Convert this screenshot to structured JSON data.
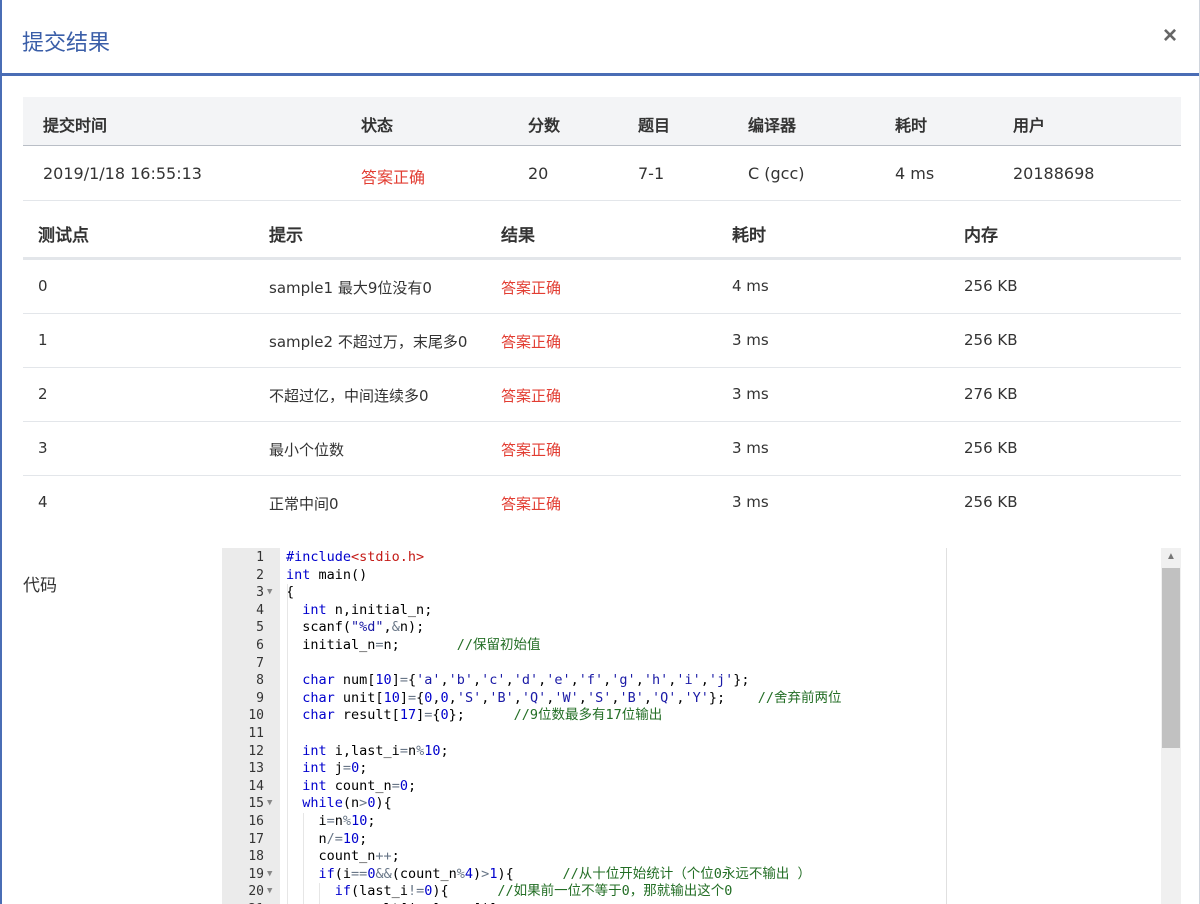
{
  "modal": {
    "title": "提交结果",
    "close": "×"
  },
  "summary": {
    "headers": [
      "提交时间",
      "状态",
      "分数",
      "题目",
      "编译器",
      "耗时",
      "用户"
    ],
    "row": [
      "2019/1/18 16:55:13",
      "答案正确",
      "20",
      "7-1",
      "C (gcc)",
      "4 ms",
      "20188698"
    ]
  },
  "cases": {
    "headers": [
      "测试点",
      "提示",
      "结果",
      "耗时",
      "内存"
    ],
    "rows": [
      [
        "0",
        "sample1 最大9位没有0",
        "答案正确",
        "4 ms",
        "256 KB"
      ],
      [
        "1",
        "sample2 不超过万，末尾多0",
        "答案正确",
        "3 ms",
        "256 KB"
      ],
      [
        "2",
        "不超过亿，中间连续多0",
        "答案正确",
        "3 ms",
        "276 KB"
      ],
      [
        "3",
        "最小个位数",
        "答案正确",
        "3 ms",
        "256 KB"
      ],
      [
        "4",
        "正常中间0",
        "答案正确",
        "3 ms",
        "256 KB"
      ]
    ]
  },
  "code": {
    "label": "代码",
    "lines": [
      "#include<stdio.h>",
      "int main()",
      "{",
      "  int n,initial_n;",
      "  scanf(\"%d\",&n);",
      "  initial_n=n;       //保留初始值",
      "",
      "  char num[10]={'a','b','c','d','e','f','g','h','i','j'};",
      "  char unit[10]={0,0,'S','B','Q','W','S','B','Q','Y'};    //舍弃前两位",
      "  char result[17]={0};      //9位数最多有17位输出",
      "",
      "  int i,last_i=n%10;",
      "  int j=0;",
      "  int count_n=0;",
      "  while(n>0){",
      "    i=n%10;",
      "    n/=10;",
      "    count_n++;",
      "    if(i==0&&(count_n%4)>1){      //从十位开始统计（个位0永远不输出 ）",
      "      if(last_i!=0){      //如果前一位不等于0，那就输出这个0",
      "        result[j++]=num[i];"
    ]
  }
}
